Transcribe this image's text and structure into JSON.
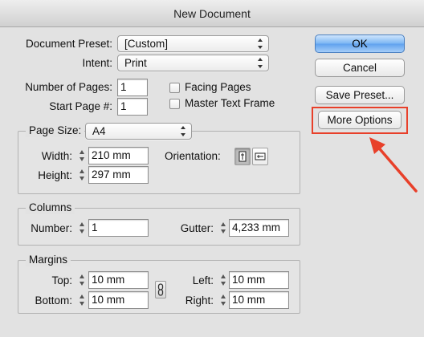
{
  "window": {
    "title": "New Document"
  },
  "document_preset": {
    "label": "Document Preset:",
    "value": "[Custom]"
  },
  "intent": {
    "label": "Intent:",
    "value": "Print"
  },
  "number_of_pages": {
    "label": "Number of Pages:",
    "value": "1"
  },
  "start_page": {
    "label": "Start Page #:",
    "value": "1"
  },
  "facing_pages": {
    "label": "Facing Pages",
    "checked": false
  },
  "master_text_frame": {
    "label": "Master Text Frame",
    "checked": false
  },
  "buttons": {
    "ok": "OK",
    "cancel": "Cancel",
    "save_preset": "Save Preset...",
    "more_options": "More Options"
  },
  "page_size": {
    "label": "Page Size:",
    "value": "A4",
    "width_label": "Width:",
    "width_value": "210 mm",
    "height_label": "Height:",
    "height_value": "297 mm",
    "orientation_label": "Orientation:",
    "orientation_selected": "portrait"
  },
  "columns": {
    "title": "Columns",
    "number_label": "Number:",
    "number_value": "1",
    "gutter_label": "Gutter:",
    "gutter_value": "4,233 mm"
  },
  "margins": {
    "title": "Margins",
    "top_label": "Top:",
    "top_value": "10 mm",
    "bottom_label": "Bottom:",
    "bottom_value": "10 mm",
    "left_label": "Left:",
    "left_value": "10 mm",
    "right_label": "Right:",
    "right_value": "10 mm"
  },
  "annotation": {
    "color": "#e8402a",
    "target": "more_options"
  }
}
